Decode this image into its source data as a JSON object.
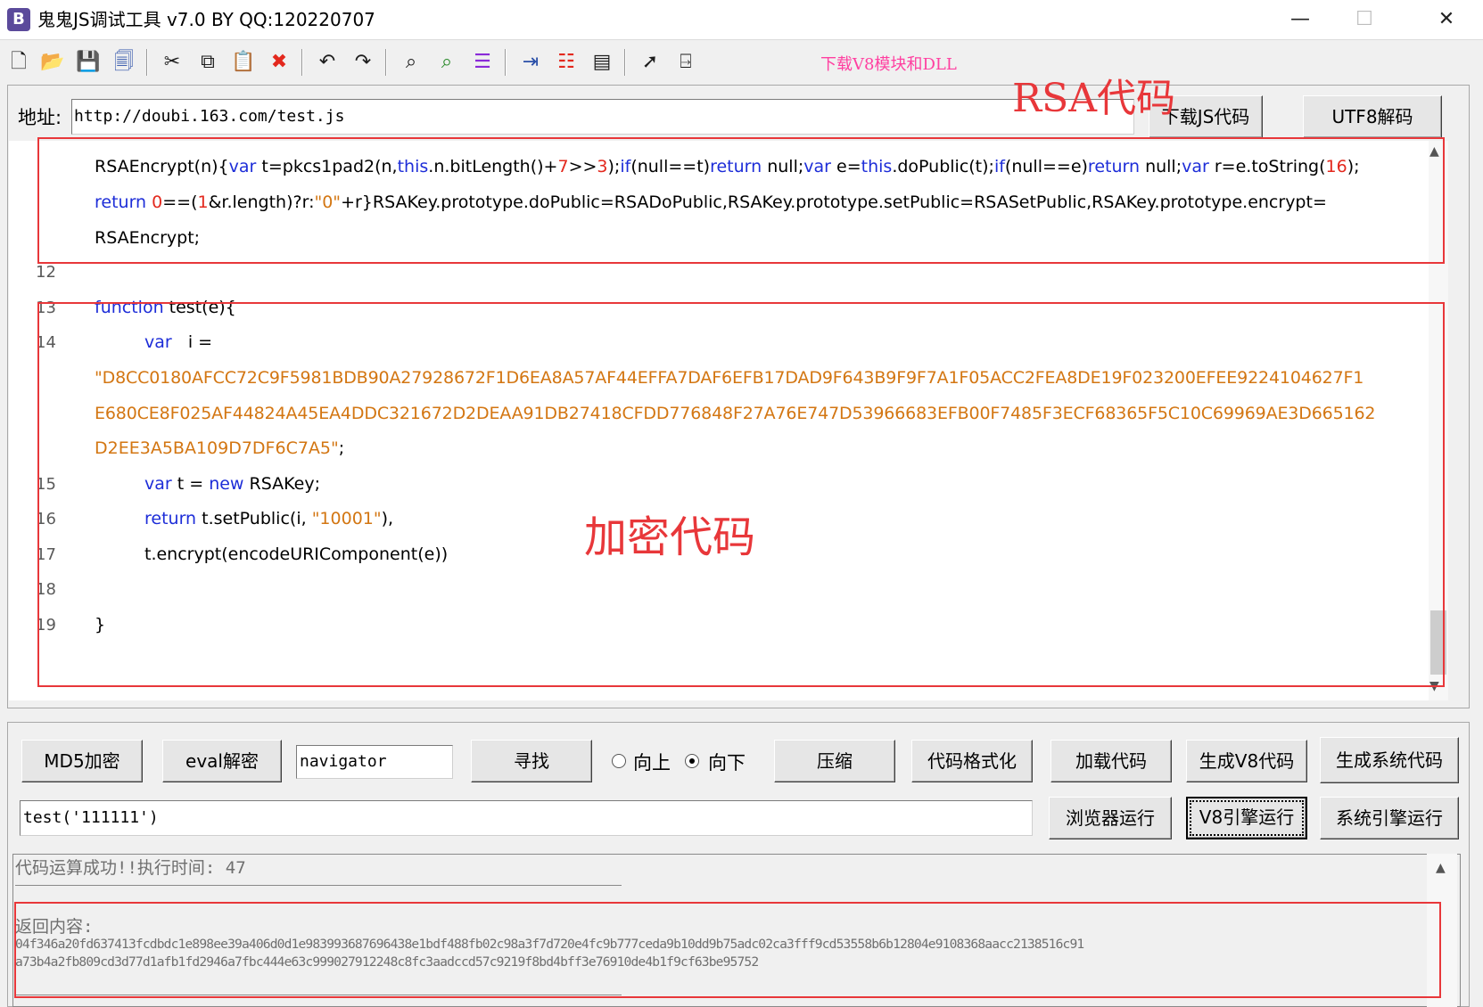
{
  "window": {
    "title": "鬼鬼JS调试工具 v7.0 BY QQ:120220707",
    "app_icon": "B",
    "minimize": "—",
    "maximize": "☐",
    "close": "✕"
  },
  "toolbar": {
    "download_v8_dll": "下载V8模块和DLL",
    "icons": [
      "new-file-icon",
      "open-folder-icon",
      "save-icon",
      "save-all-icon",
      "cut-icon",
      "copy-icon",
      "paste-icon",
      "delete-icon",
      "undo-icon",
      "redo-icon",
      "find-icon",
      "find-next-icon",
      "replace-icon",
      "indent-icon",
      "numbered-list-icon",
      "window-icon",
      "help-cursor-icon",
      "exit-icon"
    ]
  },
  "address": {
    "label": "地址:",
    "value": "http://doubi.163.com/test.js",
    "download_js_button": "下载JS代码",
    "utf8_decode_button": "UTF8解码"
  },
  "annotations": {
    "rsa_code": "RSA代码",
    "encrypt_code": "加密代码"
  },
  "editor": {
    "line_numbers": [
      "12",
      "13",
      "14",
      "15",
      "16",
      "17",
      "18",
      "19"
    ],
    "code": {
      "rsa_1": {
        "a": "RSAEncrypt(n){",
        "b": "var",
        "c": " t=pkcs1pad2(n,",
        "d": "this",
        "e": ".n.bitLength()+",
        "f": "7",
        ">": ">>",
        "g": "3",
        "h": ");",
        "i": "if",
        "j": "(null==t)",
        "k": "return",
        "l": " null;",
        "m": "var",
        "n": " e=",
        "o": "this",
        "p": ".doPublic(t);",
        "q": "if",
        "r": "(null==e)",
        "s": "return",
        "t": " null;",
        "u": "var",
        "v": " r=e.toString(",
        "w": "16",
        "x": ");"
      },
      "rsa_2": {
        "a": "return",
        "b": " ",
        "c": "0",
        "d": "==(",
        "e": "1",
        "f": "&r.length)?r:",
        "g": "\"0\"",
        "h": "+r}RSAKey.prototype.doPublic=RSADoPublic,RSAKey.prototype.setPublic=RSASetPublic,RSAKey.prototype.encrypt="
      },
      "rsa_3": "RSAEncrypt;",
      "fn_kw": "function",
      "fn_rest": " test(e){",
      "var_i_kw": "var",
      "var_i_rest": "   i =",
      "hex_1": "\"D8CC0180AFCC72C9F5981BDB90A27928672F1D6EA8A57AF44EFFA7DAF6EFB17DAD9F643B9F9F7A1F05ACC2FEA8DE19F023200EFEE9224104627F1",
      "hex_2": "E680CE8F025AF44824A45EA4DDC321672D2DEAA91DB27418CFDD776848F27A76E747D53966683EFB00F7485F3ECF68365F5C10C69969AE3D665162",
      "hex_3": "D2EE3A5BA109D7DF6C7A5\"",
      "hex_3_end": ";",
      "var_t_kw": "var",
      "var_t_mid": " t = ",
      "new_kw": "new",
      "var_t_end": " RSAKey;",
      "return_kw": "return",
      "return_mid": " t.setPublic(i, ",
      "return_str": "\"10001\"",
      "return_end": "),",
      "encrypt_line": "t.encrypt(encodeURIComponent(e))",
      "close_brace": "}"
    }
  },
  "controls": {
    "md5_button": "MD5加密",
    "eval_decode_button": "eval解密",
    "search_value": "navigator",
    "find_button": "寻找",
    "radio_up": "向上",
    "radio_down": "向下",
    "compress_button": "压缩",
    "format_button": "代码格式化",
    "load_code_button": "加载代码",
    "gen_v8_button": "生成V8代码",
    "gen_system_button": "生成系统代码",
    "command_value": "test('111111')",
    "browser_run_button": "浏览器运行",
    "v8_run_button": "V8引擎运行",
    "system_run_button": "系统引擎运行"
  },
  "output": {
    "status": "代码运算成功!!执行时间: 47",
    "return_label": "返回内容:",
    "line_1": "04f346a20fd637413fcdbdc1e898ee39a406d0d1e983993687696438e1bdf488fb02c98a3f7d720e4fc9b777ceda9b10dd9b75adc02ca3fff9cd53558b6b12804e9108368aacc2138516c91",
    "line_2": "a73b4a2fb809cd3d77d1afb1fd2946a7fbc444e63c999027912248c8fc3aadccd57c9219f8bd4bff3e76910de4b1f9cf63be95752"
  }
}
